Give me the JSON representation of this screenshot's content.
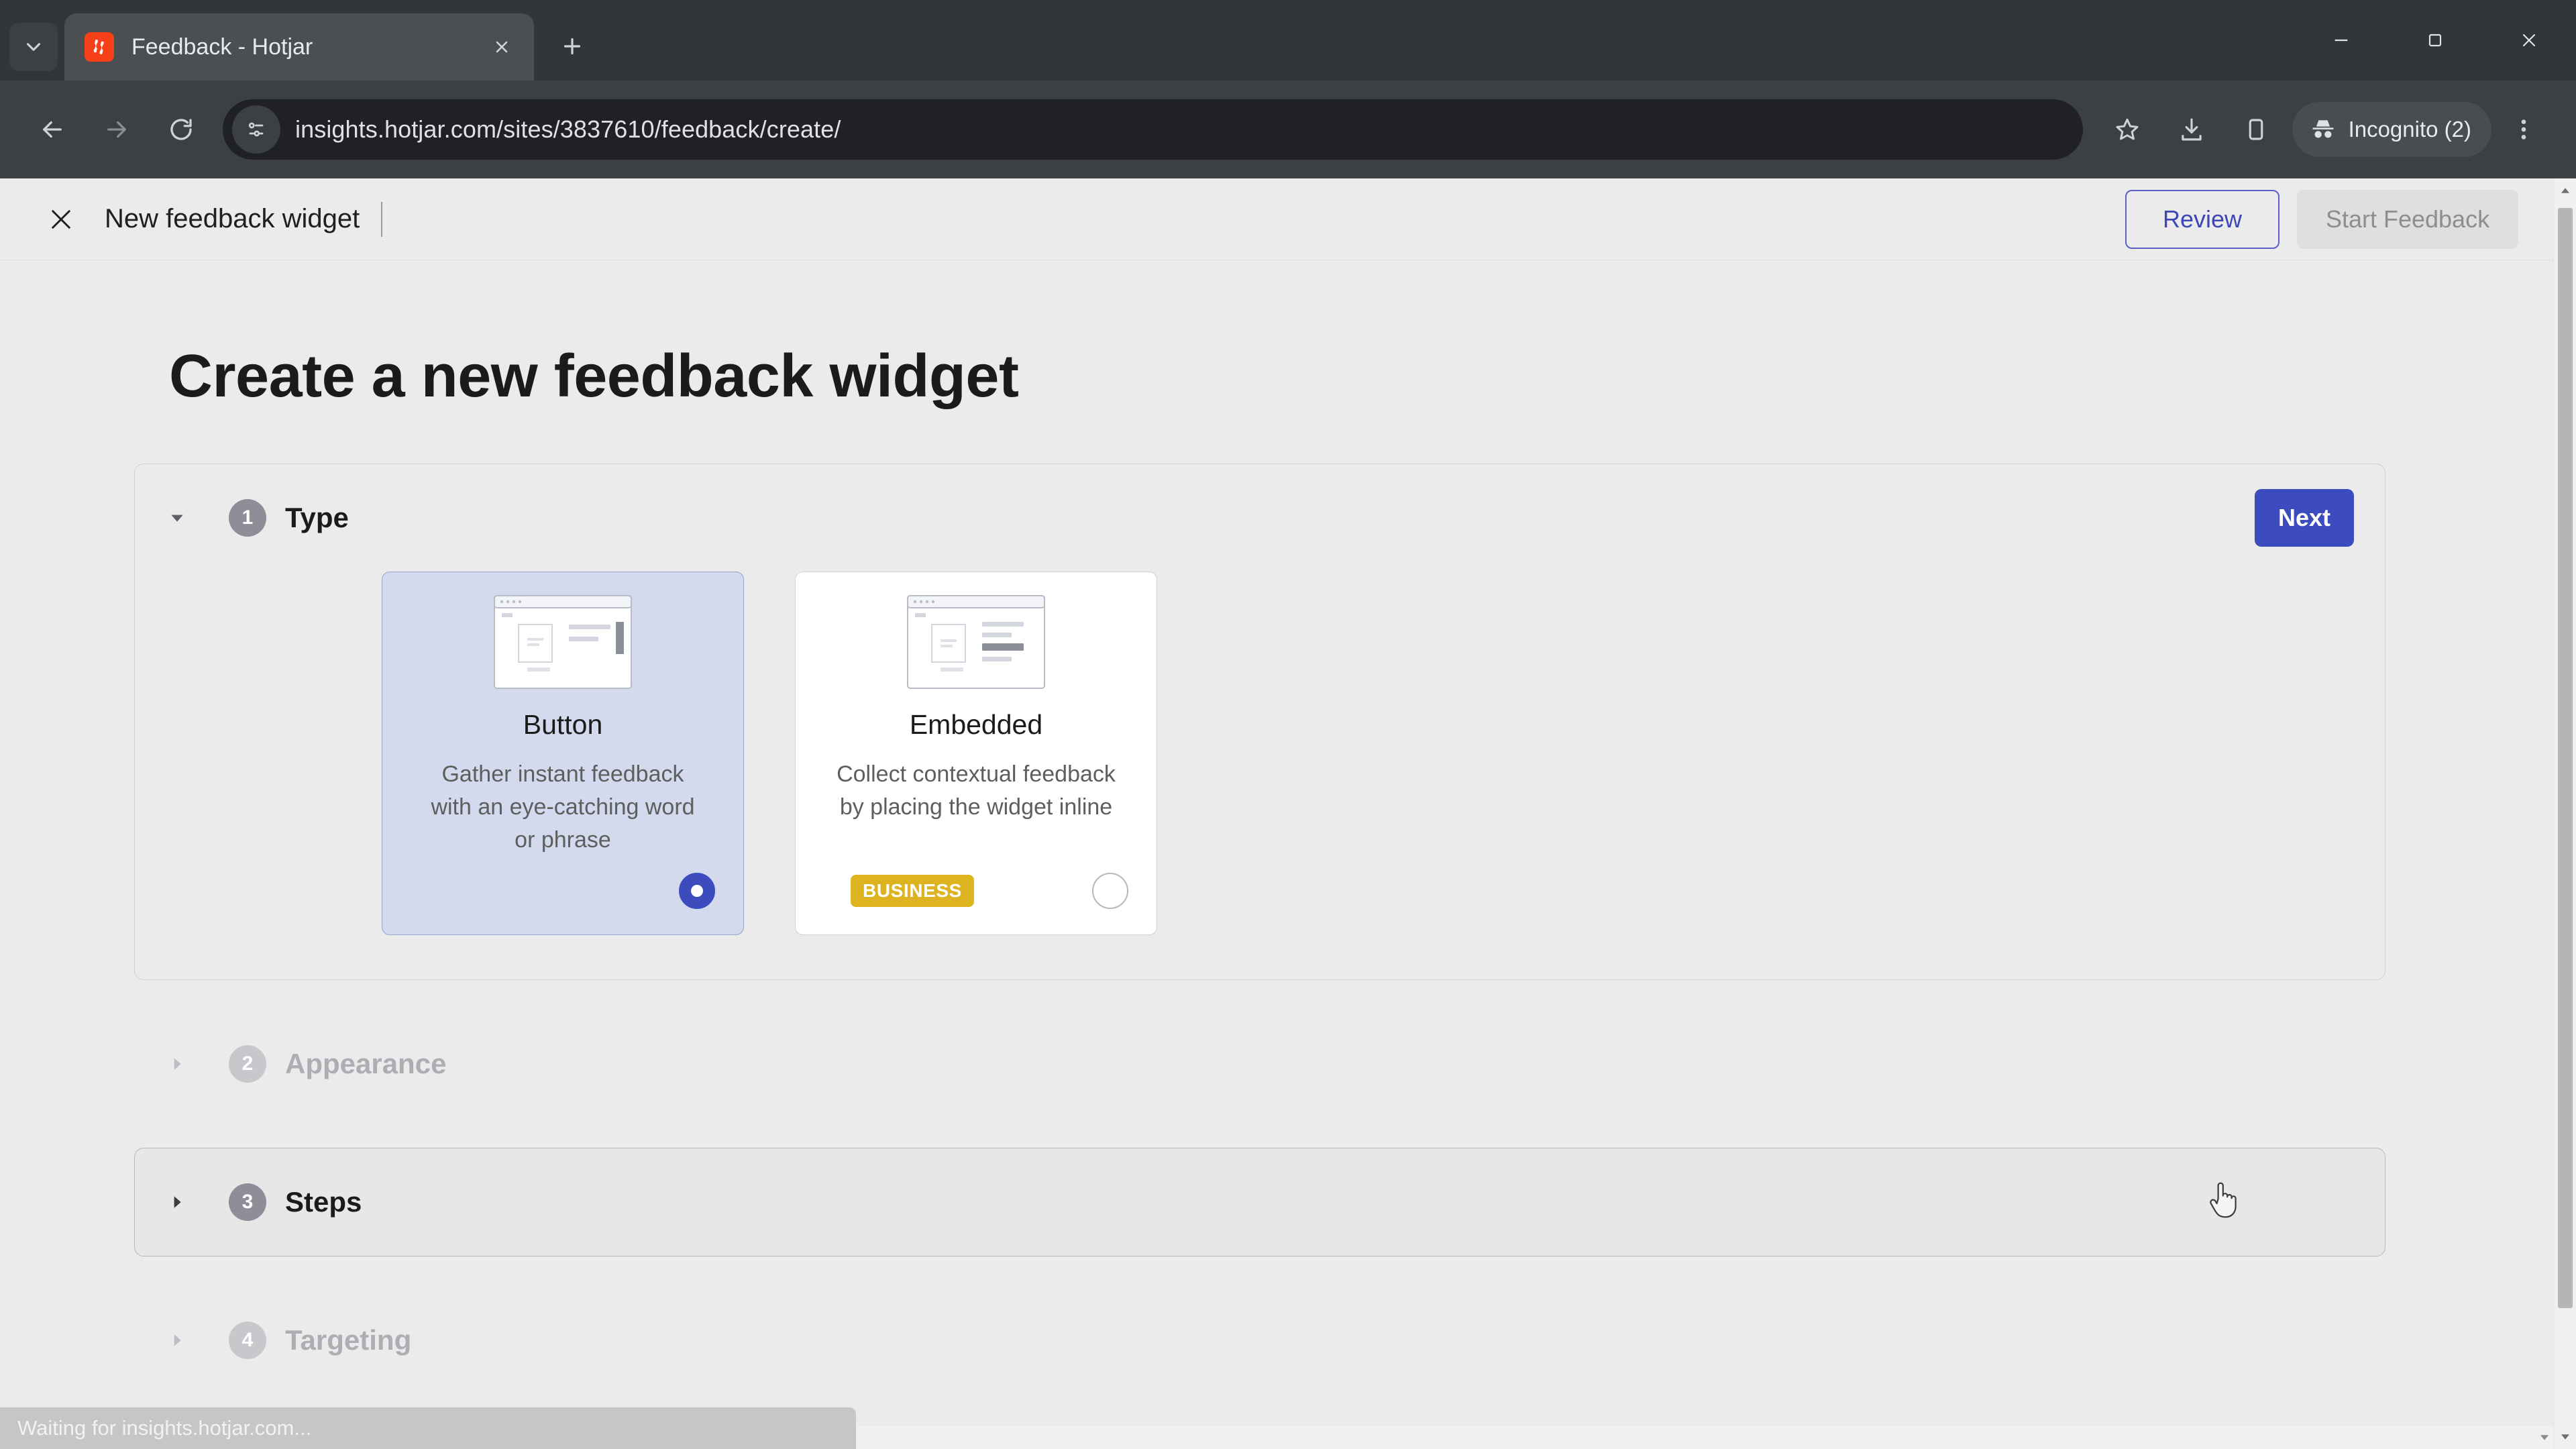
{
  "browser": {
    "tab": {
      "title": "Feedback - Hotjar",
      "favicon": "hotjar-favicon"
    },
    "tab_search_icon": "chevron-down-icon",
    "new_tab_icon": "plus-icon",
    "window_controls": [
      "minimize",
      "maximize",
      "close"
    ],
    "nav": {
      "back_icon": "back-arrow-icon",
      "forward_icon": "forward-arrow-icon",
      "reload_icon": "reload-icon"
    },
    "omnibox": {
      "site_info_icon": "page-info-icon",
      "url": "insights.hotjar.com/sites/3837610/feedback/create/"
    },
    "actions": {
      "bookmark_icon": "star-icon",
      "downloads_icon": "download-icon",
      "side_panel_icon": "side-panel-icon",
      "menu_icon": "kebab-menu-icon"
    },
    "incognito": {
      "label": "Incognito (2)",
      "icon": "incognito-icon"
    },
    "status_text": "Waiting for insights.hotjar.com..."
  },
  "app": {
    "close_icon": "close-x-icon",
    "title": "New feedback widget",
    "review_label": "Review",
    "start_feedback_label": "Start Feedback",
    "heading": "Create a new feedback widget"
  },
  "colors": {
    "accent": "#3c4bbd",
    "review_border": "#5b5fc7",
    "selected_card_bg": "#d3daee",
    "business_badge": "#ddb320",
    "disabled_text": "#8e8e8e"
  },
  "steps": [
    {
      "number": "1",
      "label": "Type",
      "expanded": true,
      "muted": false,
      "caret": "caret-down-icon",
      "next_label": "Next"
    },
    {
      "number": "2",
      "label": "Appearance",
      "expanded": false,
      "muted": true,
      "caret": "caret-right-icon"
    },
    {
      "number": "3",
      "label": "Steps",
      "expanded": false,
      "muted": false,
      "caret": "caret-right-icon"
    },
    {
      "number": "4",
      "label": "Targeting",
      "expanded": false,
      "muted": true,
      "caret": "caret-right-icon"
    }
  ],
  "type_options": [
    {
      "name": "Button",
      "description": "Gather instant feedback with an eye-catching word or phrase",
      "selected": true,
      "badge": null,
      "illustration": "browser-with-side-button-mock"
    },
    {
      "name": "Embedded",
      "description": "Collect contextual feedback by placing the widget inline",
      "selected": false,
      "badge": "BUSINESS",
      "illustration": "browser-with-inline-widget-mock"
    }
  ]
}
